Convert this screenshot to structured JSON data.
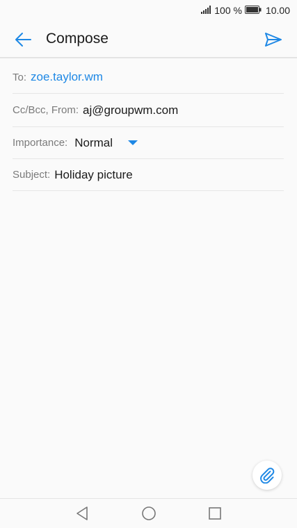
{
  "status_bar": {
    "battery_percent": "100 %",
    "time": "10.00"
  },
  "app_bar": {
    "title": "Compose"
  },
  "form": {
    "to": {
      "label": "To:",
      "value": "zoe.taylor.wm"
    },
    "cc_bcc_from": {
      "label": "Cc/Bcc, From:",
      "value": "aj@groupwm.com"
    },
    "importance": {
      "label": "Importance:",
      "value": "Normal"
    },
    "subject": {
      "label": "Subject:",
      "value": "Holiday picture"
    }
  },
  "colors": {
    "accent": "#1e88e5",
    "label": "#7a7a7a",
    "background": "#fafafa"
  }
}
